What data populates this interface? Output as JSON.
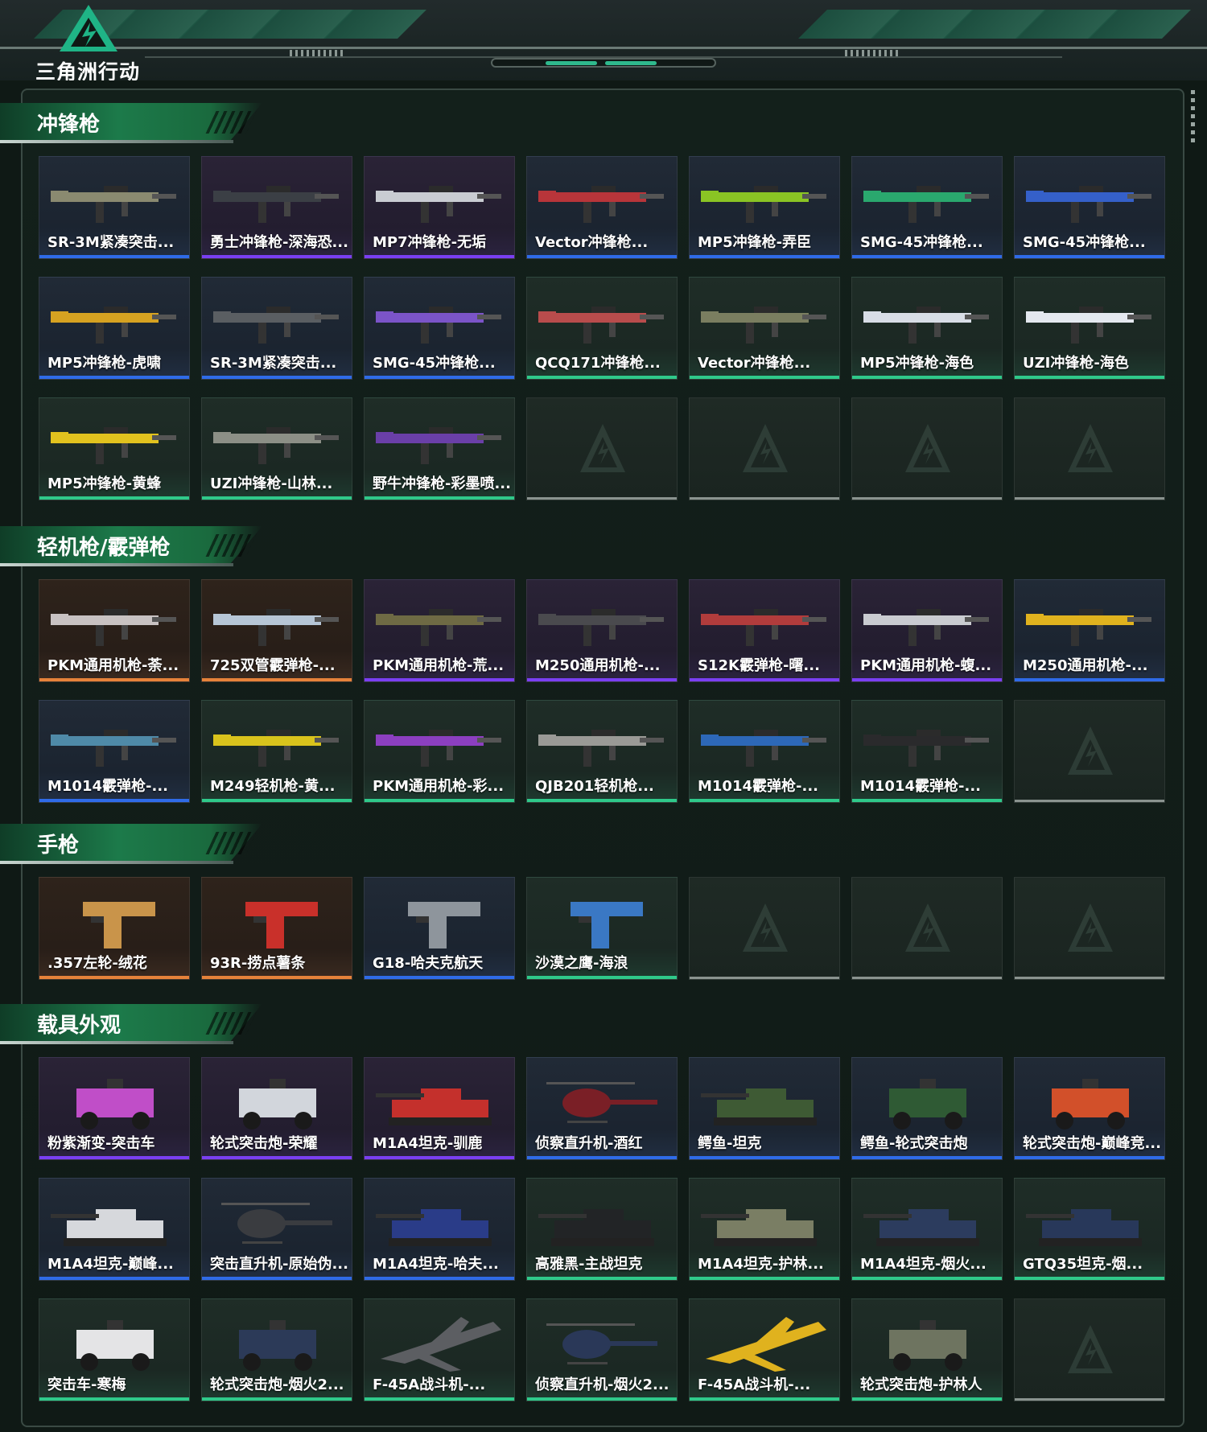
{
  "header": {
    "logo_text": "三角洲行动",
    "accent": "#2fb98d"
  },
  "colors": {
    "purple": "#7a3ff2",
    "blue": "#2f6be8",
    "green": "#2fc98a",
    "orange": "#e6823a",
    "empty": "#8a938f"
  },
  "sections": [
    {
      "title": "冲锋枪",
      "icon": "weapon-icon",
      "items": [
        {
          "label": "SR-3M紧凑突击...",
          "rarity": "blue",
          "type": "gun",
          "color": "#8a8a70"
        },
        {
          "label": "勇士冲锋枪-深海恐...",
          "rarity": "purple",
          "type": "gun",
          "color": "#3b3f45"
        },
        {
          "label": "MP7冲锋枪-无垢",
          "rarity": "purple",
          "type": "gun",
          "color": "#c9ccd2"
        },
        {
          "label": "Vector冲锋枪...",
          "rarity": "blue",
          "type": "gun",
          "color": "#b8353a"
        },
        {
          "label": "MP5冲锋枪-弄臣",
          "rarity": "blue",
          "type": "gun",
          "color": "#8ac424"
        },
        {
          "label": "SMG-45冲锋枪...",
          "rarity": "blue",
          "type": "gun",
          "color": "#2aa86e"
        },
        {
          "label": "SMG-45冲锋枪...",
          "rarity": "blue",
          "type": "gun",
          "color": "#3560c9"
        },
        {
          "label": "MP5冲锋枪-虎啸",
          "rarity": "blue",
          "type": "gun",
          "color": "#d6a221"
        },
        {
          "label": "SR-3M紧凑突击...",
          "rarity": "blue",
          "type": "gun",
          "color": "#5a5e62"
        },
        {
          "label": "SMG-45冲锋枪...",
          "rarity": "blue",
          "type": "gun",
          "color": "#7b54c8"
        },
        {
          "label": "QCQ171冲锋枪...",
          "rarity": "green",
          "type": "gun",
          "color": "#b84c4c"
        },
        {
          "label": "Vector冲锋枪...",
          "rarity": "green",
          "type": "gun",
          "color": "#7a7e60"
        },
        {
          "label": "MP5冲锋枪-海色",
          "rarity": "green",
          "type": "gun",
          "color": "#d8dde6"
        },
        {
          "label": "UZI冲锋枪-海色",
          "rarity": "green",
          "type": "gun",
          "color": "#e4e8ef"
        },
        {
          "label": "MP5冲锋枪-黄蜂",
          "rarity": "green",
          "type": "gun",
          "color": "#e1c21e"
        },
        {
          "label": "UZI冲锋枪-山林...",
          "rarity": "green",
          "type": "gun",
          "color": "#8c8f86"
        },
        {
          "label": "野牛冲锋枪-彩墨喷...",
          "rarity": "green",
          "type": "gun",
          "color": "#6a3fa8"
        },
        {
          "label": "",
          "rarity": "empty"
        },
        {
          "label": "",
          "rarity": "empty"
        },
        {
          "label": "",
          "rarity": "empty"
        },
        {
          "label": "",
          "rarity": "empty"
        }
      ]
    },
    {
      "title": "轻机枪/霰弹枪",
      "icon": "weapon-icon",
      "items": [
        {
          "label": "PKM通用机枪-荼...",
          "rarity": "orange",
          "type": "gun",
          "color": "#c8c2c2"
        },
        {
          "label": "725双管霰弹枪-...",
          "rarity": "orange",
          "type": "gun",
          "color": "#b6c6d6"
        },
        {
          "label": "PKM通用机枪-荒...",
          "rarity": "purple",
          "type": "gun",
          "color": "#6e6a44"
        },
        {
          "label": "M250通用机枪-...",
          "rarity": "purple",
          "type": "gun",
          "color": "#4a4a4e"
        },
        {
          "label": "S12K霰弹枪-曙...",
          "rarity": "purple",
          "type": "gun",
          "color": "#b13c3c"
        },
        {
          "label": "PKM通用机枪-蝮...",
          "rarity": "purple",
          "type": "gun",
          "color": "#c9cbd0"
        },
        {
          "label": "M250通用机枪-...",
          "rarity": "blue",
          "type": "gun",
          "color": "#e0b21e"
        },
        {
          "label": "M1014霰弹枪-...",
          "rarity": "blue",
          "type": "gun",
          "color": "#4f8aa8"
        },
        {
          "label": "M249轻机枪-黄...",
          "rarity": "green",
          "type": "gun",
          "color": "#d9c31c"
        },
        {
          "label": "PKM通用机枪-彩...",
          "rarity": "green",
          "type": "gun",
          "color": "#8c3fc0"
        },
        {
          "label": "QJB201轻机枪...",
          "rarity": "green",
          "type": "gun",
          "color": "#9a9a96"
        },
        {
          "label": "M1014霰弹枪-...",
          "rarity": "green",
          "type": "gun",
          "color": "#2d68b8"
        },
        {
          "label": "M1014霰弹枪-...",
          "rarity": "green",
          "type": "gun",
          "color": "#2a2a2c"
        },
        {
          "label": "",
          "rarity": "empty"
        }
      ]
    },
    {
      "title": "手枪",
      "icon": "weapon-icon",
      "items": [
        {
          "label": ".357左轮-绒花",
          "rarity": "orange",
          "type": "pistol",
          "color": "#c9944a"
        },
        {
          "label": "93R-捞点薯条",
          "rarity": "orange",
          "type": "pistol",
          "color": "#c9302a"
        },
        {
          "label": "G18-哈夫克航天",
          "rarity": "blue",
          "type": "pistol",
          "color": "#8e959c"
        },
        {
          "label": "沙漠之鹰-海浪",
          "rarity": "green",
          "type": "pistol",
          "color": "#3a78c4"
        },
        {
          "label": "",
          "rarity": "empty"
        },
        {
          "label": "",
          "rarity": "empty"
        },
        {
          "label": "",
          "rarity": "empty"
        }
      ]
    },
    {
      "title": "载具外观",
      "icon": "vehicle-icon",
      "items": [
        {
          "label": "粉紫渐变-突击车",
          "rarity": "purple",
          "type": "car",
          "color": "#c04ec8"
        },
        {
          "label": "轮式突击炮-荣耀",
          "rarity": "purple",
          "type": "car",
          "color": "#d2d6dc"
        },
        {
          "label": "M1A4坦克-驯鹿",
          "rarity": "purple",
          "type": "tank",
          "color": "#c4302c"
        },
        {
          "label": "侦察直升机-酒红",
          "rarity": "blue",
          "type": "heli",
          "color": "#7a1f26"
        },
        {
          "label": "鳄鱼-坦克",
          "rarity": "blue",
          "type": "tank",
          "color": "#3e5a34"
        },
        {
          "label": "鳄鱼-轮式突击炮",
          "rarity": "blue",
          "type": "car",
          "color": "#2f5a34"
        },
        {
          "label": "轮式突击炮-巅峰竞...",
          "rarity": "blue",
          "type": "car",
          "color": "#d2502a"
        },
        {
          "label": "M1A4坦克-巅峰...",
          "rarity": "blue",
          "type": "tank",
          "color": "#d6d8dc"
        },
        {
          "label": "突击直升机-原始伪...",
          "rarity": "blue",
          "type": "heli",
          "color": "#3a3c40"
        },
        {
          "label": "M1A4坦克-哈夫...",
          "rarity": "blue",
          "type": "tank",
          "color": "#2a3c88"
        },
        {
          "label": "高雅黑-主战坦克",
          "rarity": "green",
          "type": "tank",
          "color": "#222426"
        },
        {
          "label": "M1A4坦克-护林...",
          "rarity": "green",
          "type": "tank",
          "color": "#7a7e64"
        },
        {
          "label": "M1A4坦克-烟火...",
          "rarity": "green",
          "type": "tank",
          "color": "#2c3c5e"
        },
        {
          "label": "GTQ35坦克-烟...",
          "rarity": "green",
          "type": "tank",
          "color": "#28385a"
        },
        {
          "label": "突击车-寒梅",
          "rarity": "green",
          "type": "car",
          "color": "#e4e4e6"
        },
        {
          "label": "轮式突击炮-烟火2...",
          "rarity": "green",
          "type": "car",
          "color": "#2c3a58"
        },
        {
          "label": "F-45A战斗机-...",
          "rarity": "green",
          "type": "jet",
          "color": "#5c5e62"
        },
        {
          "label": "侦察直升机-烟火2...",
          "rarity": "green",
          "type": "heli",
          "color": "#2a3858"
        },
        {
          "label": "F-45A战斗机-...",
          "rarity": "green",
          "type": "jet",
          "color": "#e0b21e"
        },
        {
          "label": "轮式突击炮-护林人",
          "rarity": "green",
          "type": "car",
          "color": "#6e7460"
        },
        {
          "label": "",
          "rarity": "empty"
        }
      ]
    }
  ]
}
